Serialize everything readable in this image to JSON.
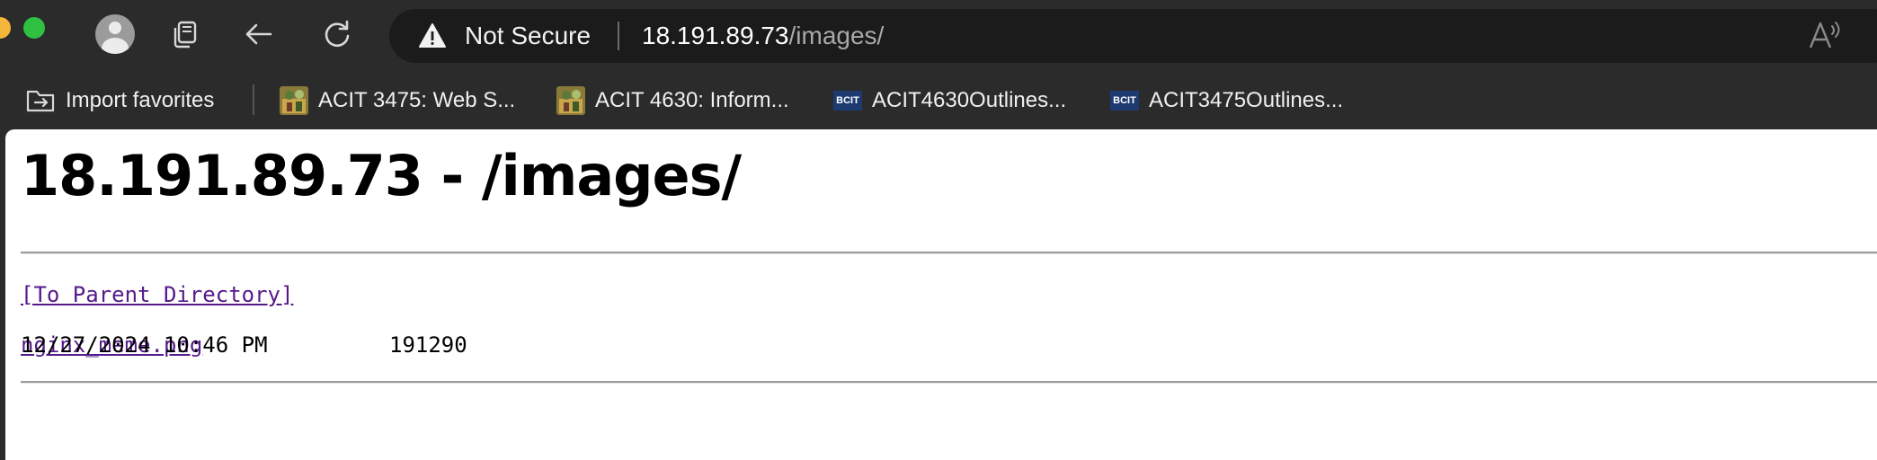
{
  "toolbar": {
    "profile_icon": "avatar-icon",
    "tabs_icon": "tab-actions-icon",
    "back_icon": "back-arrow-icon",
    "refresh_icon": "refresh-icon"
  },
  "addressbar": {
    "security_label": "Not Secure",
    "url_host": "18.191.89.73",
    "url_path": "/images/",
    "read_aloud_icon": "read-aloud-icon"
  },
  "bookmarks": {
    "import_label": "Import favorites",
    "items": [
      {
        "label": "ACIT 3475: Web S...",
        "icon": "course-thumbnail-icon"
      },
      {
        "label": "ACIT 4630: Inform...",
        "icon": "course-thumbnail-icon"
      },
      {
        "label": "ACIT4630Outlines...",
        "icon": "bcit-logo-icon",
        "logo_text": "BCIT"
      },
      {
        "label": "ACIT3475Outlines...",
        "icon": "bcit-logo-icon",
        "logo_text": "BCIT"
      }
    ]
  },
  "page": {
    "title": "18.191.89.73 - /images/",
    "parent_link": "[To Parent Directory]",
    "files": [
      {
        "date": "12/27/2024 10:46 PM",
        "size": "191290",
        "name": "nginx_meme.png"
      }
    ]
  },
  "colors": {
    "chrome_bg": "#2b2b2b",
    "addressbar_bg": "#1b1b1b",
    "visited_link": "#551a8b",
    "bcit_blue": "#1d3b71"
  }
}
